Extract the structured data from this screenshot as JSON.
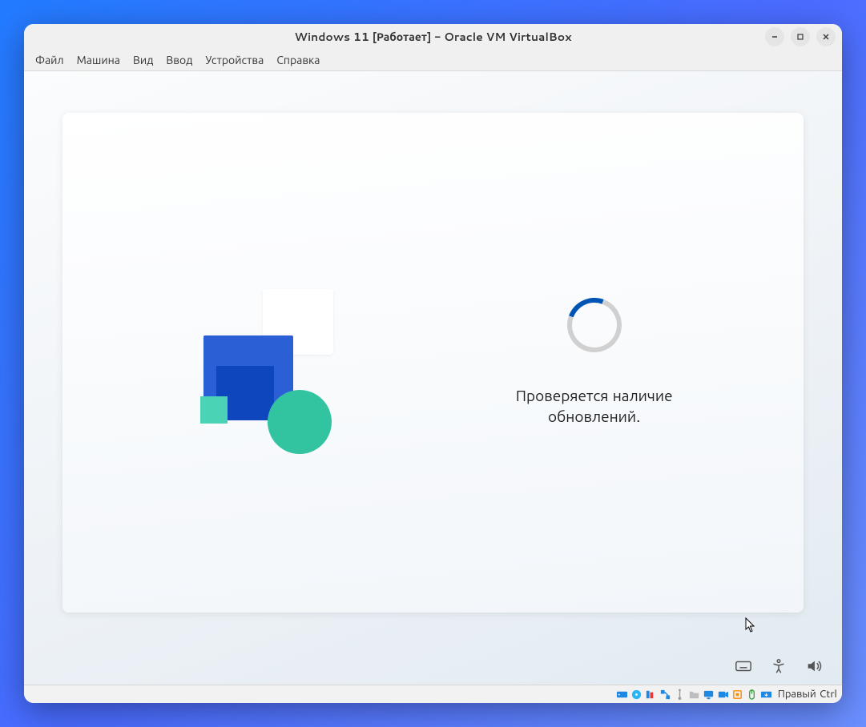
{
  "window": {
    "title": "Windows 11 [Работает] - Oracle VM VirtualBox"
  },
  "menubar": {
    "items": [
      "Файл",
      "Машина",
      "Вид",
      "Ввод",
      "Устройства",
      "Справка"
    ]
  },
  "oobe": {
    "status_line1": "Проверяется наличие",
    "status_line2": "обновлений."
  },
  "statusbar": {
    "host_key": "Правый Ctrl",
    "icons": [
      "hard-disk-icon",
      "optical-disc-icon",
      "audio-icon",
      "network-icon",
      "usb-icon",
      "shared-folders-icon",
      "display-icon",
      "recording-icon",
      "cpu-icon",
      "mouse-integration-icon",
      "keyboard-capture-icon"
    ]
  },
  "oobe_tray": {
    "icons": [
      "keyboard-icon",
      "accessibility-icon",
      "volume-icon"
    ]
  },
  "colors": {
    "accent": "#0054b3"
  }
}
